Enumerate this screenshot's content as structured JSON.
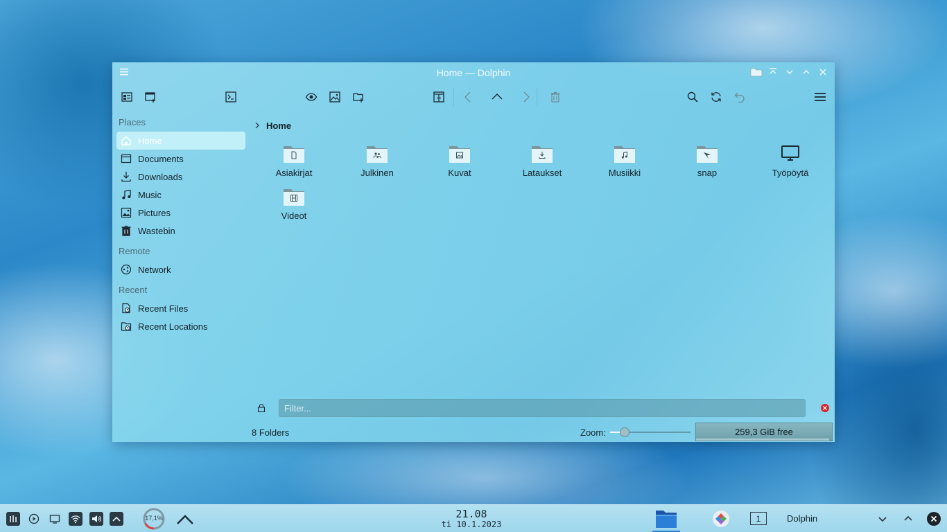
{
  "window": {
    "title": "Home — Dolphin"
  },
  "sidebar": {
    "places_title": "Places",
    "places": [
      {
        "label": "Home",
        "icon": "home-icon",
        "active": true
      },
      {
        "label": "Documents",
        "icon": "document-icon"
      },
      {
        "label": "Downloads",
        "icon": "download-icon"
      },
      {
        "label": "Music",
        "icon": "music-icon"
      },
      {
        "label": "Pictures",
        "icon": "picture-icon"
      },
      {
        "label": "Wastebin",
        "icon": "trash-icon"
      }
    ],
    "remote_title": "Remote",
    "remote": [
      {
        "label": "Network",
        "icon": "network-icon"
      }
    ],
    "recent_title": "Recent",
    "recent": [
      {
        "label": "Recent Files",
        "icon": "recent-files-icon"
      },
      {
        "label": "Recent Locations",
        "icon": "recent-locations-icon"
      }
    ]
  },
  "breadcrumb": {
    "current": "Home"
  },
  "items": [
    {
      "name": "Asiakirjat",
      "icon": "folder-documents-icon"
    },
    {
      "name": "Julkinen",
      "icon": "folder-public-icon"
    },
    {
      "name": "Kuvat",
      "icon": "folder-pictures-icon"
    },
    {
      "name": "Lataukset",
      "icon": "folder-download-icon"
    },
    {
      "name": "Musiikki",
      "icon": "folder-music-icon"
    },
    {
      "name": "snap",
      "icon": "folder-snap-icon"
    },
    {
      "name": "Työpöytä",
      "icon": "desktop-icon"
    },
    {
      "name": "Videot",
      "icon": "folder-videos-icon"
    }
  ],
  "filter": {
    "placeholder": "Filter..."
  },
  "status": {
    "count": "8 Folders",
    "zoom_label": "Zoom:",
    "zoom_level": 0.18,
    "free_space": "259,3 GiB free",
    "used_fraction": 0.98
  },
  "taskbar": {
    "cpu_label": "17,1%",
    "cpu_fraction": 0.171,
    "time": "21.08",
    "date": "ti 10.1.2023",
    "pager": "1",
    "active_task": "Dolphin"
  },
  "colors": {
    "accent": "#2b7fd6",
    "close_red": "#d9232b",
    "folder": "#e3f5f9"
  }
}
